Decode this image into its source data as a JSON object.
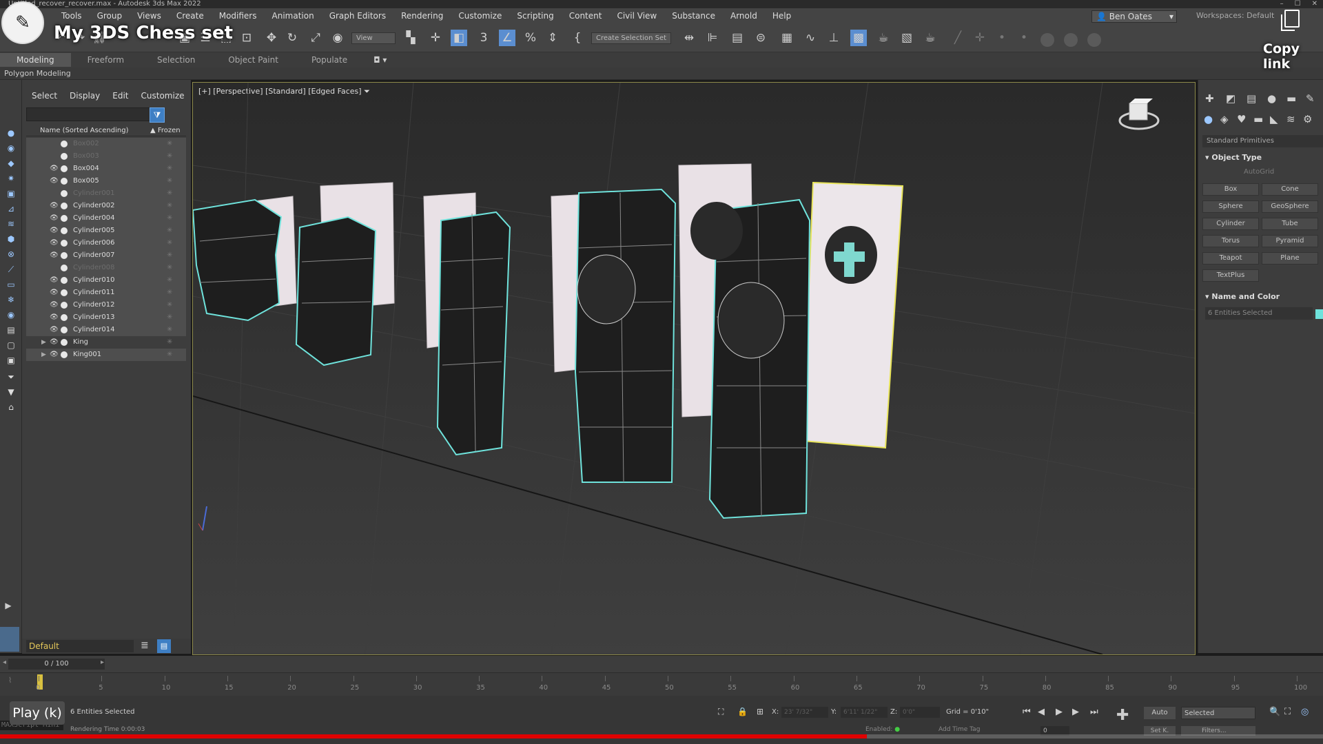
{
  "window": {
    "title": "Untitled_recover_recover.max - Autodesk 3ds Max 2022",
    "controls": [
      "–",
      "☐",
      "✕"
    ]
  },
  "menu": [
    "Tools",
    "Group",
    "Views",
    "Create",
    "Modifiers",
    "Animation",
    "Graph Editors",
    "Rendering",
    "Customize",
    "Scripting",
    "Content",
    "Civil View",
    "Substance",
    "Arnold",
    "Help"
  ],
  "user": {
    "name": "Ben Oates",
    "workspaces_label": "Workspaces:",
    "workspace": "Default"
  },
  "toolbar": {
    "view_dropdown": "View",
    "selection_set": "Create Selection Set"
  },
  "ribbon": {
    "tabs": [
      "Modeling",
      "Freeform",
      "Selection",
      "Object Paint",
      "Populate"
    ],
    "active": "Modeling",
    "sublabel": "Polygon Modeling"
  },
  "explorer": {
    "menu": [
      "Select",
      "Display",
      "Edit",
      "Customize"
    ],
    "header_name": "Name (Sorted Ascending)",
    "header_frozen": "▲ Frozen",
    "rows": [
      {
        "name": "Box002",
        "visible": false,
        "selected": true,
        "dim": true
      },
      {
        "name": "Box003",
        "visible": false,
        "selected": true,
        "dim": true
      },
      {
        "name": "Box004",
        "visible": true,
        "selected": true,
        "dim": false
      },
      {
        "name": "Box005",
        "visible": true,
        "selected": true,
        "dim": false
      },
      {
        "name": "Cylinder001",
        "visible": false,
        "selected": true,
        "dim": true
      },
      {
        "name": "Cylinder002",
        "visible": true,
        "selected": true,
        "dim": false
      },
      {
        "name": "Cylinder004",
        "visible": true,
        "selected": true,
        "dim": false
      },
      {
        "name": "Cylinder005",
        "visible": true,
        "selected": true,
        "dim": false
      },
      {
        "name": "Cylinder006",
        "visible": true,
        "selected": true,
        "dim": false
      },
      {
        "name": "Cylinder007",
        "visible": true,
        "selected": true,
        "dim": false
      },
      {
        "name": "Cylinder008",
        "visible": false,
        "selected": true,
        "dim": true
      },
      {
        "name": "Cylinder010",
        "visible": true,
        "selected": true,
        "dim": false
      },
      {
        "name": "Cylinder011",
        "visible": true,
        "selected": true,
        "dim": false
      },
      {
        "name": "Cylinder012",
        "visible": true,
        "selected": true,
        "dim": false
      },
      {
        "name": "Cylinder013",
        "visible": true,
        "selected": true,
        "dim": false
      },
      {
        "name": "Cylinder014",
        "visible": true,
        "selected": true,
        "dim": false
      },
      {
        "name": "King",
        "visible": true,
        "selected": false,
        "dim": false,
        "expandable": true
      },
      {
        "name": "King001",
        "visible": true,
        "selected": true,
        "dim": false,
        "expandable": true
      }
    ],
    "layer": "Default"
  },
  "viewport": {
    "label": "[+] [Perspective] [Standard] [Edged Faces]"
  },
  "command_panel": {
    "category": "Standard Primitives",
    "object_type_header": "Object Type",
    "autogrid": "AutoGrid",
    "buttons": [
      "Box",
      "Cone",
      "Sphere",
      "GeoSphere",
      "Cylinder",
      "Tube",
      "Torus",
      "Pyramid",
      "Teapot",
      "Plane",
      "TextPlus"
    ],
    "name_color_header": "Name and Color",
    "name_field": "6 Entities Selected",
    "object_color": "#6fe3dc"
  },
  "timeline": {
    "frame": "0 / 100",
    "ticks": [
      "0",
      "5",
      "10",
      "15",
      "20",
      "25",
      "30",
      "35",
      "40",
      "45",
      "50",
      "55",
      "60",
      "65",
      "70",
      "75",
      "80",
      "85",
      "90",
      "95",
      "100"
    ]
  },
  "status": {
    "selection": "6 Entities Selected",
    "render_time": "Rendering Time  0:00:03",
    "maxscript": "MAXScript Mini",
    "x_label": "X:",
    "x_value": "23' 7/32\"",
    "y_label": "Y:",
    "y_value": "6'11' 1/22\"",
    "z_label": "Z:",
    "z_value": "0'0\"",
    "grid": "Grid = 0'10\"",
    "auto": "Auto",
    "selected": "Selected",
    "set_k": "Set K.",
    "filters": "Filters...",
    "enabled": "Enabled:",
    "add_time_tag": "Add Time Tag",
    "frame_field": "0"
  },
  "youtube": {
    "title": "My 3DS Chess set",
    "copy_link": "Copy link",
    "play": "Play (k)",
    "progress": 0.655
  }
}
